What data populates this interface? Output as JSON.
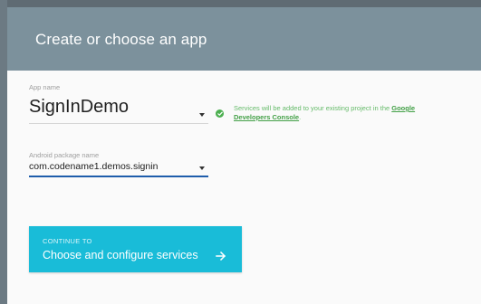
{
  "header": {
    "title": "Create or choose an app"
  },
  "app_name": {
    "label": "App name",
    "value": "SignInDemo"
  },
  "status": {
    "text": "Services will be added to your existing project in the ",
    "link_text": "Google Developers Console",
    "suffix": ".",
    "color": "#4caf50"
  },
  "package_name": {
    "label": "Android package name",
    "value": "com.codename1.demos.signin"
  },
  "continue_button": {
    "small_label": "CONTINUE TO",
    "main_label": "Choose and configure services",
    "color": "#19bcd8"
  },
  "icons": {
    "app_dropdown": "chevron-down-icon",
    "package_dropdown": "chevron-down-icon",
    "status": "check-circle-icon",
    "continue": "arrow-right-icon"
  },
  "colors": {
    "header": "#7c919c",
    "focus_underline": "#1e5dab"
  }
}
